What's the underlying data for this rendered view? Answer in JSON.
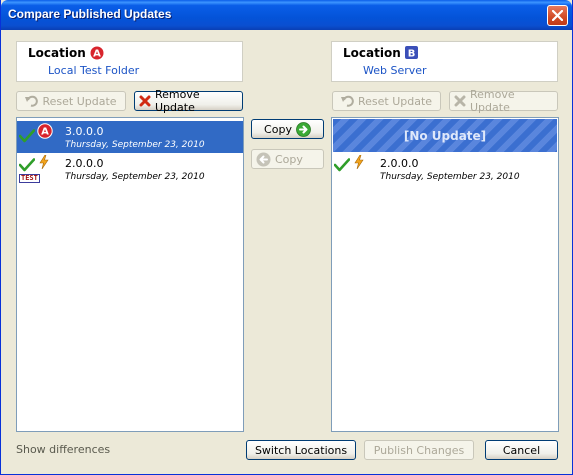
{
  "window": {
    "title": "Compare Published Updates"
  },
  "left_location": {
    "label": "Location",
    "value": "Local Test Folder",
    "badge": "A",
    "badge_color": "#d8242c"
  },
  "right_location": {
    "label": "Location",
    "value": "Web Server",
    "badge": "B",
    "badge_color": "#3b4fb8"
  },
  "left_buttons": {
    "reset": "Reset Update",
    "remove": "Remove Update"
  },
  "right_buttons": {
    "reset": "Reset Update",
    "remove": "Remove Update"
  },
  "copy_buttons": {
    "right": "Copy",
    "left": "Copy"
  },
  "left_list": [
    {
      "version": "3.0.0.0",
      "date": "Thursday, September 23, 2010",
      "selected": true,
      "badge": "A"
    },
    {
      "version": "2.0.0.0",
      "date": "Thursday, September 23, 2010",
      "selected": false,
      "tag": "TEST"
    }
  ],
  "right_list": {
    "placeholder": "[No Update]",
    "items": [
      {
        "version": "2.0.0.0",
        "date": "Thursday, September 23, 2010"
      }
    ]
  },
  "footer": {
    "show_differences": "Show differences",
    "switch": "Switch Locations",
    "publish": "Publish Changes",
    "cancel": "Cancel"
  }
}
